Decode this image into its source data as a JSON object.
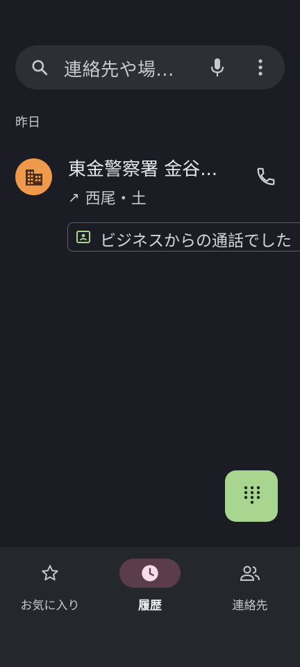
{
  "search": {
    "placeholder": "連絡先や場..."
  },
  "section": {
    "header": "昨日"
  },
  "call_log": {
    "items": [
      {
        "name": "東金警察署 金谷...",
        "direction_icon": "↗",
        "meta": "西尾・土",
        "avatar_icon": "building-icon",
        "avatar_color": "#ef9a4b",
        "chip_label": "ビジネスからの通話でした"
      }
    ]
  },
  "fab": {
    "icon": "dialpad-icon",
    "color": "#a8d58f"
  },
  "bottom_nav": {
    "items": [
      {
        "label": "お気に入り",
        "icon": "star-icon",
        "active": false
      },
      {
        "label": "履歴",
        "icon": "clock-icon",
        "active": true
      },
      {
        "label": "連絡先",
        "icon": "people-icon",
        "active": false
      }
    ],
    "active_color": "#5b3d4a"
  },
  "colors": {
    "background": "#1c1d24",
    "search_bar": "#2c2f33",
    "nav_bar": "#24272b"
  }
}
